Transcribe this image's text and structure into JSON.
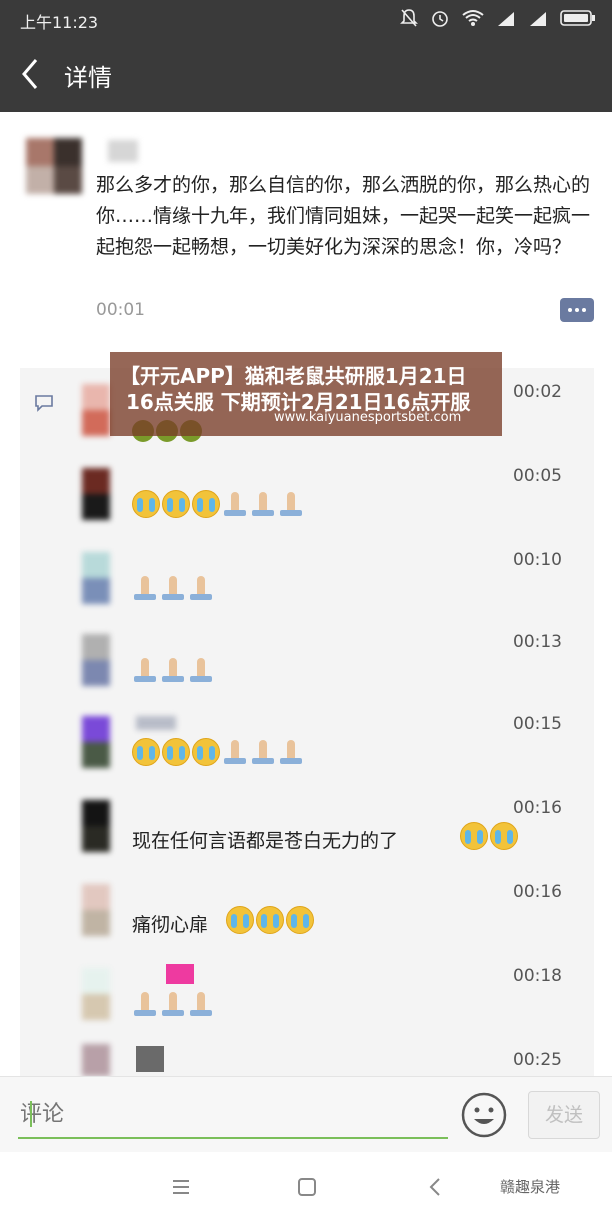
{
  "status_bar": {
    "time": "上午11:23",
    "icons": [
      "mute-icon",
      "alarm-icon",
      "wifi-icon",
      "signal-icon",
      "signal-icon",
      "battery-icon"
    ]
  },
  "header": {
    "title": "详情"
  },
  "post": {
    "content": "那么多才的你，那么自信的你，那么洒脱的你，那么热心的你……情缘十九年，我们情同姐妹，一起哭一起笑一起疯一起抱怨一起畅想，一切美好化为深深的思念！你，冷吗？",
    "timestamp": "00:01"
  },
  "comments": [
    {
      "time": "00:02",
      "text": "",
      "emoji": [
        "frog",
        "frog",
        "frog"
      ]
    },
    {
      "time": "00:05",
      "text": "",
      "emoji": [
        "cry",
        "cry",
        "cry",
        "pray",
        "pray",
        "pray"
      ]
    },
    {
      "time": "00:10",
      "text": "",
      "emoji": [
        "pray",
        "pray",
        "pray"
      ]
    },
    {
      "time": "00:13",
      "text": "",
      "emoji": [
        "pray",
        "pray",
        "pray"
      ]
    },
    {
      "time": "00:15",
      "text": "",
      "emoji": [
        "cry",
        "cry",
        "cry",
        "pray",
        "pray",
        "pray"
      ]
    },
    {
      "time": "00:16",
      "text": "现在任何言语都是苍白无力的了",
      "emoji": [
        "cry",
        "cry"
      ]
    },
    {
      "time": "00:16",
      "text": "痛彻心扉",
      "emoji": [
        "cry",
        "cry",
        "cry"
      ]
    },
    {
      "time": "00:18",
      "text": "",
      "emoji": [
        "pray",
        "pray",
        "pray"
      ]
    },
    {
      "time": "00:25",
      "text": "",
      "emoji": []
    }
  ],
  "banner": {
    "line1": "【开元APP】猫和老鼠共研服1月21日",
    "line2": "16点关服 下期预计2月21日16点开服",
    "url": "www.kaiyuanesportsbet.com"
  },
  "input": {
    "placeholder": "评论",
    "send_label": "发送"
  },
  "watermark": "赣趣泉港",
  "colors": {
    "header_bg": "#3a3a3a",
    "accent_green": "#7bbf5a",
    "link_blue": "#6a7aa0"
  }
}
